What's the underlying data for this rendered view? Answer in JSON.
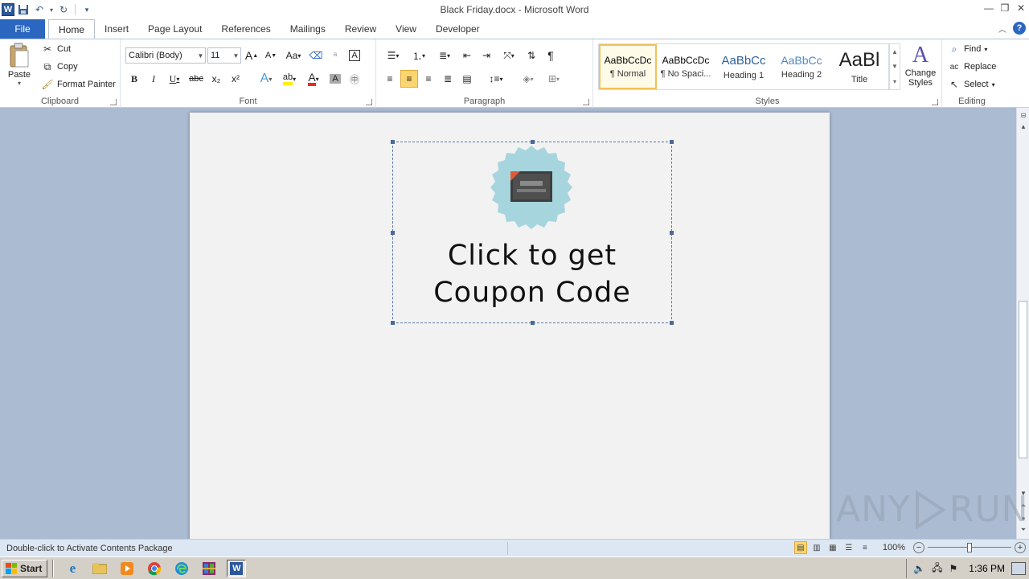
{
  "window": {
    "title": "Black Friday.docx - Microsoft Word",
    "app_icon": "W"
  },
  "tabs": [
    "File",
    "Home",
    "Insert",
    "Page Layout",
    "References",
    "Mailings",
    "Review",
    "View",
    "Developer"
  ],
  "active_tab": "Home",
  "ribbon": {
    "clipboard": {
      "label": "Clipboard",
      "paste": "Paste",
      "cut": "Cut",
      "copy": "Copy",
      "format_painter": "Format Painter"
    },
    "font": {
      "label": "Font",
      "font_name": "Calibri (Body)",
      "font_size": "11",
      "bold": "B",
      "italic": "I",
      "underline": "U",
      "strike": "abc",
      "subscript": "x₂",
      "superscript": "x²",
      "grow": "A",
      "shrink": "A",
      "change_case": "Aa"
    },
    "paragraph": {
      "label": "Paragraph",
      "pilcrow": "¶"
    },
    "styles": {
      "label": "Styles",
      "items": [
        {
          "preview": "AaBbCcDc",
          "name": "¶ Normal"
        },
        {
          "preview": "AaBbCcDc",
          "name": "¶ No Spaci..."
        },
        {
          "preview": "AaBbCc",
          "name": "Heading 1"
        },
        {
          "preview": "AaBbCc",
          "name": "Heading 2"
        },
        {
          "preview": "AaBl",
          "name": "Title"
        }
      ],
      "change_styles": "Change Styles"
    },
    "editing": {
      "label": "Editing",
      "find": "Find",
      "replace": "Replace",
      "select": "Select"
    }
  },
  "document": {
    "object_text_line1": "Click to get",
    "object_text_line2": "Coupon Code"
  },
  "statusbar": {
    "message": "Double-click to Activate Contents Package",
    "zoom": "100%",
    "zoom_fraction": 0.5
  },
  "taskbar": {
    "start": "Start",
    "time": "1:36 PM"
  },
  "watermark": "ANY RUN",
  "colors": {
    "accent": "#2b66c1",
    "doc_bg": "#aabbd2",
    "badge": "#a7d5de"
  }
}
